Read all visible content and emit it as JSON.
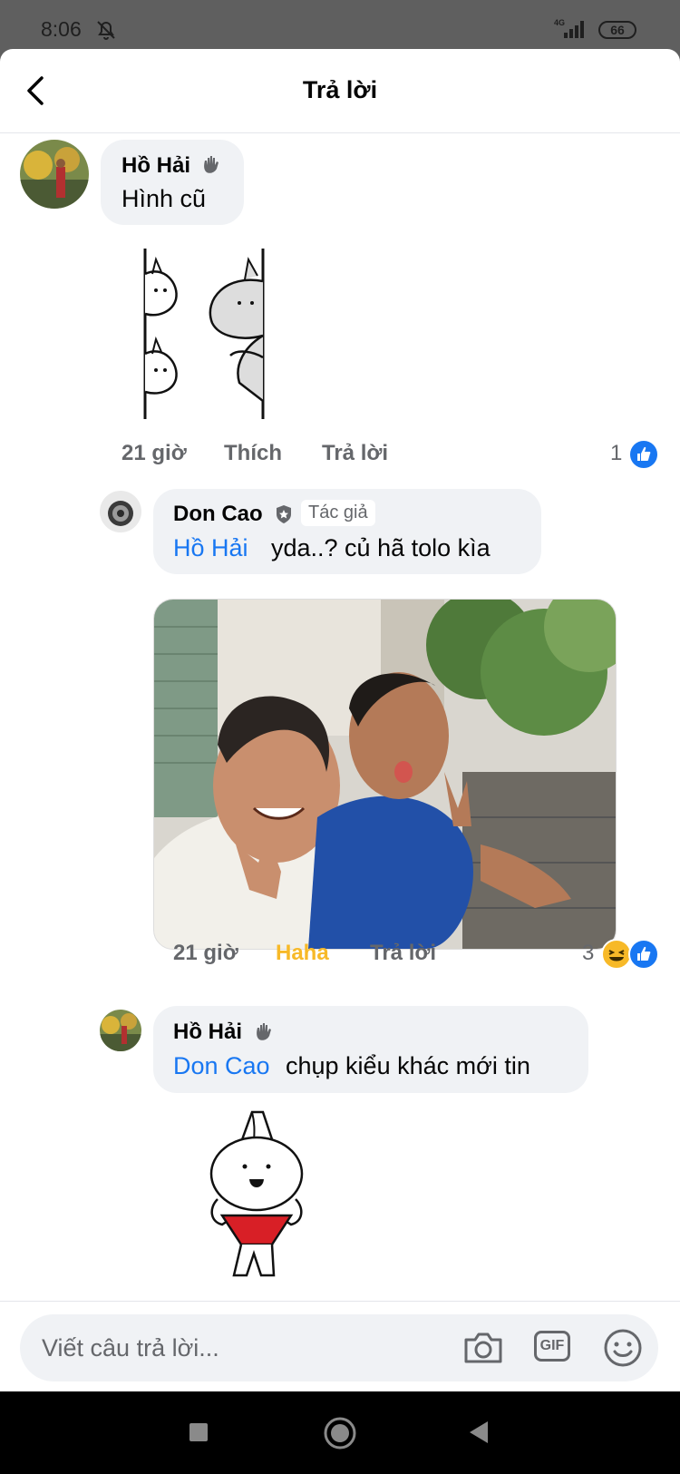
{
  "status_bar": {
    "time": "8:06",
    "network": "4G",
    "battery": "66"
  },
  "header": {
    "title": "Trả lời"
  },
  "comments": [
    {
      "author": "Hồ Hải",
      "text": "Hình cũ",
      "time": "21 giờ",
      "like_label": "Thích",
      "reply_label": "Trả lời",
      "reaction_count": "1"
    },
    {
      "author": "Don Cao",
      "badge": "Tác giả",
      "mention": "Hồ Hải",
      "text": "yda..? củ hã tolo kìa",
      "time": "21 giờ",
      "like_label": "Haha",
      "reply_label": "Trả lời",
      "reaction_count": "3"
    },
    {
      "author": "Hồ Hải",
      "mention": "Don Cao",
      "text": "chụp kiểu khác mới tin"
    }
  ],
  "composer": {
    "placeholder": "Viết câu trả lời...",
    "gif_label": "GIF"
  },
  "colors": {
    "accent": "#1877f2",
    "haha": "#f7b928",
    "bubble": "#f0f2f5"
  }
}
